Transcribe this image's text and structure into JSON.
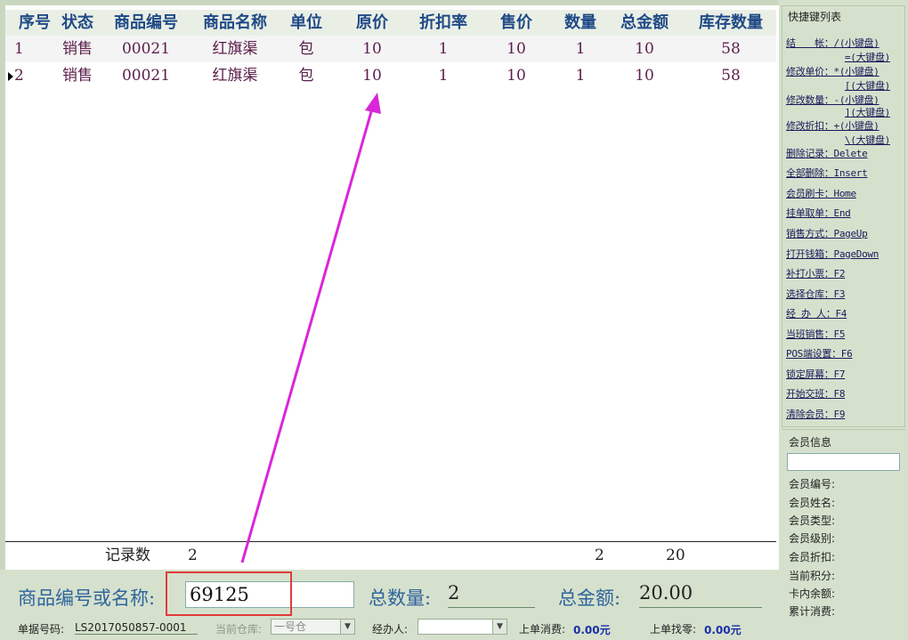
{
  "grid": {
    "headers": [
      "序号",
      "状态",
      "商品编号",
      "商品名称",
      "单位",
      "原价",
      "折扣率",
      "售价",
      "数量",
      "总金额",
      "库存数量"
    ],
    "rows": [
      {
        "no": "1",
        "status": "销售",
        "code": "00021",
        "name": "红旗渠",
        "unit": "包",
        "orig": "10",
        "disc": "1",
        "price": "10",
        "qty": "1",
        "amount": "10",
        "stock": "58"
      },
      {
        "no": "2",
        "status": "销售",
        "code": "00021",
        "name": "红旗渠",
        "unit": "包",
        "orig": "10",
        "disc": "1",
        "price": "10",
        "qty": "1",
        "amount": "10",
        "stock": "58"
      }
    ],
    "footer": {
      "label": "记录数",
      "count": "2",
      "qty_total": "2",
      "amount_total": "20"
    }
  },
  "bottom": {
    "code_label": "商品编号或名称:",
    "code_value": "69125",
    "total_qty_label": "总数量:",
    "total_qty": "2",
    "total_amount_label": "总金额:",
    "total_amount": "20.00",
    "receipt_label": "单据号码:",
    "receipt_no": "LS2017050857-0001",
    "warehouse_label": "当前仓库:",
    "warehouse_value": "一号仓",
    "handler_label": "经办人:",
    "handler_value": "",
    "last_spend_label": "上单消费:",
    "last_spend": "0.00元",
    "last_change_label": "上单找零:",
    "last_change": "0.00元"
  },
  "shortcuts": {
    "title": "快捷键列表",
    "items": [
      "结　　帐：/(小键盘)",
      "修改单价：*(小键盘)",
      "修改数量：-(小键盘)",
      "修改折扣：+(小键盘)",
      "删除记录：Delete",
      "全部删除：Insert",
      "会员刷卡：Home",
      "挂单取单：End",
      "销售方式：PageUp",
      "打开钱箱：PageDown",
      "补打小票：F2",
      "选择仓库：F3",
      "经 办 人：F4",
      "当班销售：F5",
      "POS端设置：F6",
      "锁定屏幕：F7",
      "开始交班：F8",
      "清除会员：F9"
    ],
    "subs": [
      "=(大键盘)",
      "[(大键盘)",
      "](大键盘)",
      "\\(大键盘)"
    ]
  },
  "member": {
    "title": "会员信息",
    "fields": [
      "会员编号:",
      "会员姓名:",
      "会员类型:",
      "会员级别:",
      "会员折扣:",
      "当前积分:",
      "卡内余额:",
      "累计消费:"
    ]
  },
  "colors": {
    "accent": "#d926d9",
    "highlight": "#e23a3a",
    "header_text": "#1f4a86",
    "panel": "#d5e1cd"
  }
}
